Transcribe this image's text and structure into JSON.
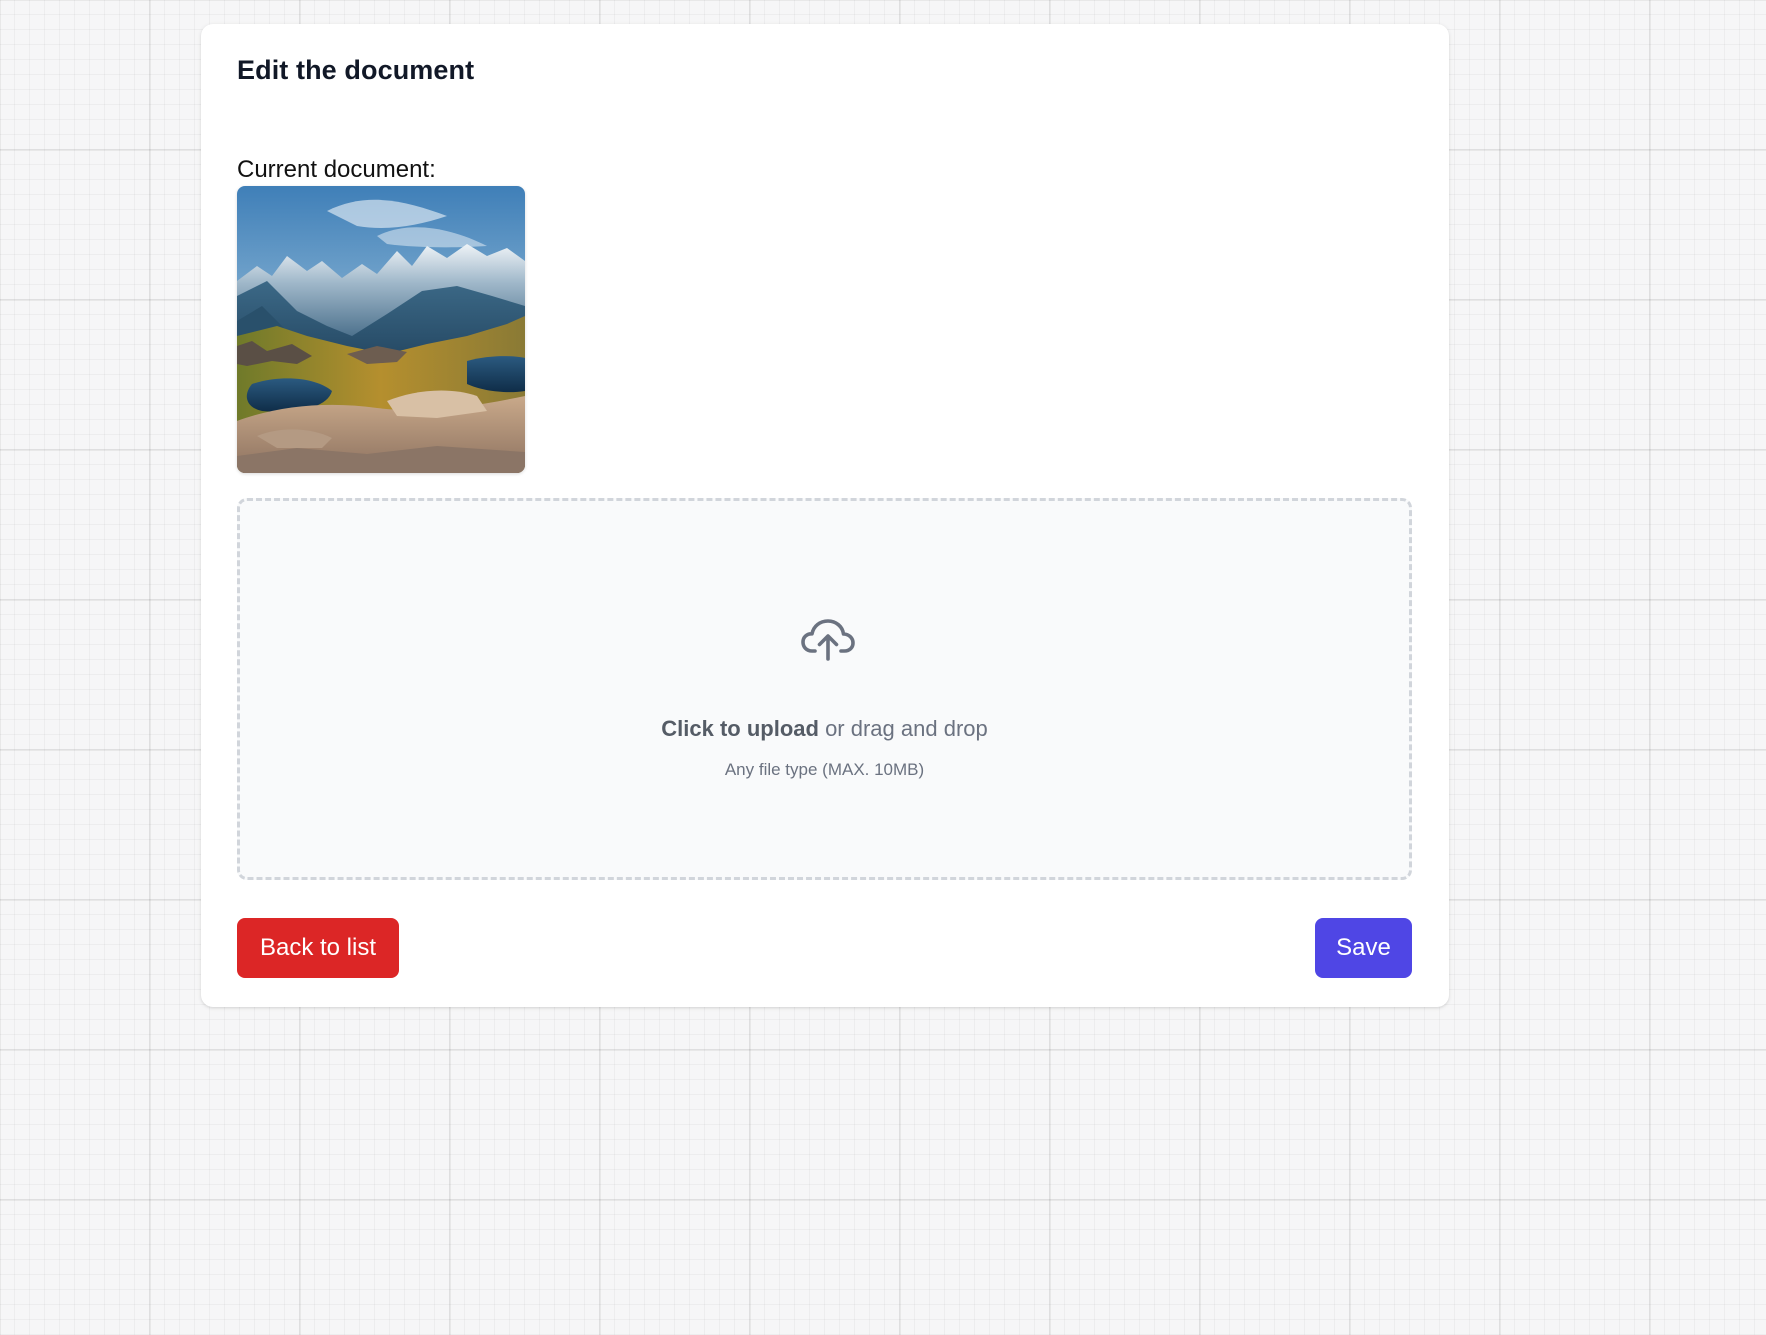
{
  "form": {
    "title": "Edit the document",
    "current_label": "Current document:",
    "current_image_alt": "mountain landscape"
  },
  "upload": {
    "icon": "cloud-upload-icon",
    "cta_strong": "Click to upload",
    "cta_rest": " or drag and drop",
    "hint": "Any file type (MAX. 10MB)"
  },
  "actions": {
    "back_label": "Back to list",
    "save_label": "Save"
  },
  "colors": {
    "back_button": "#dc2626",
    "save_button": "#4f46e5",
    "dropzone_border": "#d1d5db",
    "dropzone_bg": "#f9fafb"
  }
}
